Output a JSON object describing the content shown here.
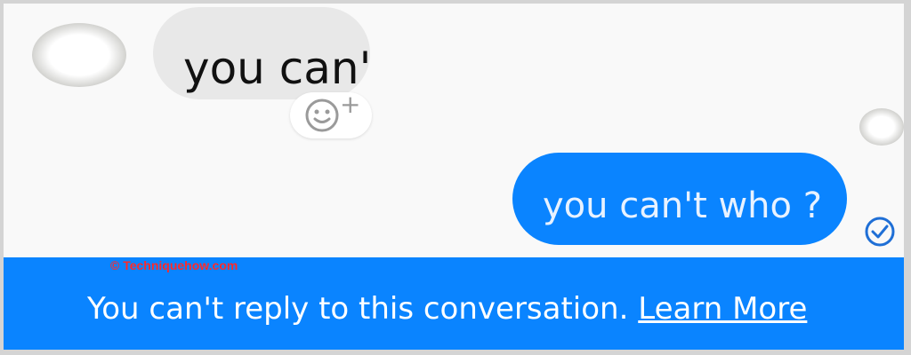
{
  "conversation": {
    "incoming_message": "you can't",
    "outgoing_message": "you can't who ?",
    "react_plus": "+",
    "icons": {
      "react": "smiley-icon",
      "delivered": "check-circle-icon"
    }
  },
  "banner": {
    "watermark": "© Techniquehow.com",
    "notice": "You can't reply to this conversation.",
    "link": "Learn More"
  },
  "colors": {
    "accent": "#0a84ff",
    "incoming_bubble": "#e8e8e8",
    "background": "#f9f9f9",
    "watermark": "#ff2a2a"
  }
}
